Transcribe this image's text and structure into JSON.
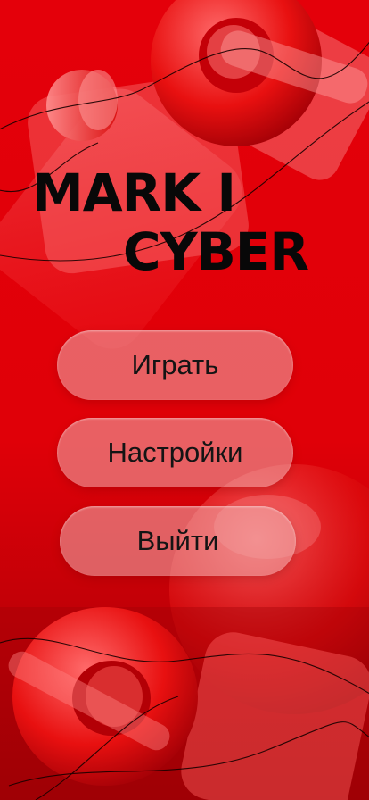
{
  "title": {
    "line1": "MARK I",
    "line2": "CYBER"
  },
  "menu": {
    "play_label": "Играть",
    "settings_label": "Настройки",
    "exit_label": "Выйти"
  },
  "colors": {
    "background": "#d90008",
    "accent": "#ff1a1a",
    "button": "#f0afaf",
    "text": "#080808"
  }
}
